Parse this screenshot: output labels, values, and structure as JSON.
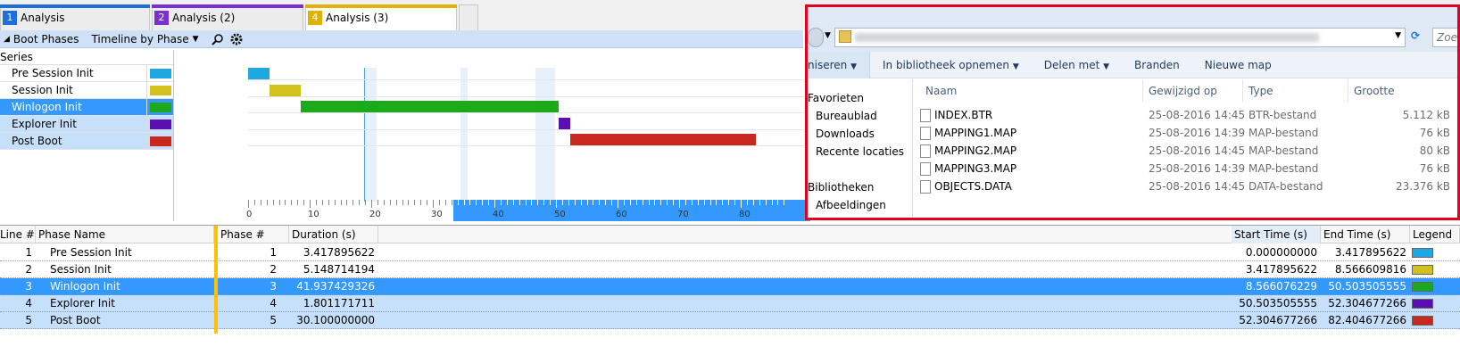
{
  "tabs": [
    {
      "num": "1",
      "label": "Analysis",
      "color": "#1e6fd9"
    },
    {
      "num": "2",
      "label": "Analysis (2)",
      "color": "#7a2fd0"
    },
    {
      "num": "4",
      "label": "Analysis (3)",
      "color": "#e2b100"
    }
  ],
  "toolbar": {
    "graph_name": "Boot Phases",
    "view_label": "Timeline by Phase",
    "search_icon": "search-icon",
    "settings_icon": "gear-icon"
  },
  "series_panel": {
    "header": "Series",
    "items": [
      {
        "label": "Pre Session Init",
        "color": "#1ea7e1"
      },
      {
        "label": "Session Init",
        "color": "#d4c21c"
      },
      {
        "label": "Winlogon Init",
        "color": "#1aaa1a"
      },
      {
        "label": "Explorer Init",
        "color": "#5b0fb0"
      },
      {
        "label": "Post Boot",
        "color": "#c8281e"
      }
    ]
  },
  "chart_data": {
    "type": "bar",
    "orientation": "horizontal-timeline",
    "x_ticks": [
      "0",
      "10",
      "20",
      "30",
      "40",
      "50",
      "60",
      "70",
      "80"
    ],
    "xlim": [
      0,
      87
    ],
    "series": [
      {
        "name": "Pre Session Init",
        "start": 0.0,
        "end": 3.417895622
      },
      {
        "name": "Session Init",
        "start": 3.417895622,
        "end": 8.566609816
      },
      {
        "name": "Winlogon Init",
        "start": 8.566076229,
        "end": 50.503505555
      },
      {
        "name": "Explorer Init",
        "start": 50.503505555,
        "end": 52.304677266
      },
      {
        "name": "Post Boot",
        "start": 52.304677266,
        "end": 82.404677266
      }
    ]
  },
  "table": {
    "headers": {
      "line": "Line #",
      "phase_name": "Phase Name",
      "phase_num": "Phase #",
      "duration": "Duration (s)",
      "start": "Start Time (s)",
      "end": "End Time (s)",
      "legend": "Legend"
    },
    "rows": [
      {
        "line": "1",
        "name": "Pre Session Init",
        "phase": "1",
        "duration": "3.417895622",
        "start": "0.000000000",
        "end": "3.417895622",
        "color": "#1ea7e1"
      },
      {
        "line": "2",
        "name": "Session Init",
        "phase": "2",
        "duration": "5.148714194",
        "start": "3.417895622",
        "end": "8.566609816",
        "color": "#d4c21c"
      },
      {
        "line": "3",
        "name": "Winlogon Init",
        "phase": "3",
        "duration": "41.937429326",
        "start": "8.566076229",
        "end": "50.503505555",
        "color": "#1aaa1a"
      },
      {
        "line": "4",
        "name": "Explorer Init",
        "phase": "4",
        "duration": "1.801171711",
        "start": "50.503505555",
        "end": "52.304677266",
        "color": "#5b0fb0"
      },
      {
        "line": "5",
        "name": "Post Boot",
        "phase": "5",
        "duration": "30.100000000",
        "start": "52.304677266",
        "end": "82.404677266",
        "color": "#c8281e"
      }
    ]
  },
  "explorer": {
    "search_placeholder": "Zoek",
    "commands": [
      "niseren",
      "In bibliotheek opnemen",
      "Delen met",
      "Branden",
      "Nieuwe map"
    ],
    "nav": {
      "favorites_header": "Favorieten",
      "favorites": [
        "Bureaublad",
        "Downloads",
        "Recente locaties"
      ],
      "libraries_header": "Bibliotheken",
      "libraries": [
        "Afbeeldingen"
      ]
    },
    "columns": {
      "name": "Naam",
      "modified": "Gewijzigd op",
      "type": "Type",
      "size": "Grootte"
    },
    "files": [
      {
        "name": "INDEX.BTR",
        "modified": "25-08-2016 14:45",
        "type": "BTR-bestand",
        "size": "5.112 kB"
      },
      {
        "name": "MAPPING1.MAP",
        "modified": "25-08-2016 14:39",
        "type": "MAP-bestand",
        "size": "76 kB"
      },
      {
        "name": "MAPPING2.MAP",
        "modified": "25-08-2016 14:45",
        "type": "MAP-bestand",
        "size": "80 kB"
      },
      {
        "name": "MAPPING3.MAP",
        "modified": "25-08-2016 14:39",
        "type": "MAP-bestand",
        "size": "76 kB"
      },
      {
        "name": "OBJECTS.DATA",
        "modified": "25-08-2016 14:45",
        "type": "DATA-bestand",
        "size": "23.376 kB"
      }
    ],
    "highlight_color": "#e3001b"
  }
}
